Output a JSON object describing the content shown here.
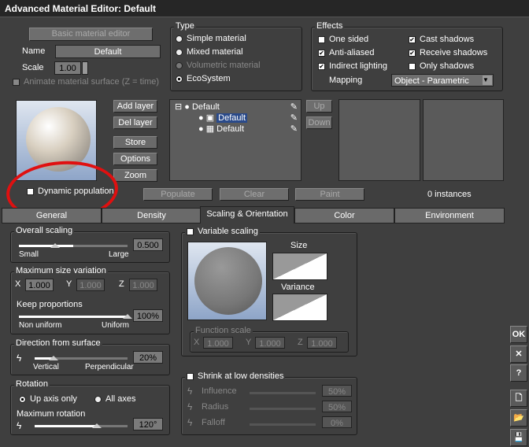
{
  "title": "Advanced Material Editor: Default",
  "basic_editor": "Basic material editor",
  "name_label": "Name",
  "name_value": "Default",
  "scale_label": "Scale",
  "scale_value": "1.00",
  "animate_label": "Animate material surface (Z = time)",
  "type": {
    "legend": "Type",
    "options": [
      "Simple material",
      "Mixed material",
      "Volumetric material",
      "EcoSystem"
    ],
    "selected": "EcoSystem"
  },
  "effects": {
    "legend": "Effects",
    "one_sided": "One sided",
    "anti_aliased": "Anti-aliased",
    "indirect_lighting": "Indirect lighting",
    "cast_shadows": "Cast shadows",
    "receive_shadows": "Receive shadows",
    "only_shadows": "Only shadows",
    "mapping_label": "Mapping",
    "mapping_value": "Object - Parametric"
  },
  "layer_buttons": [
    "Add layer",
    "Del layer",
    "Store",
    "Options",
    "Zoom"
  ],
  "tree": [
    "Default",
    "Default",
    "Default"
  ],
  "up": "Up",
  "down": "Down",
  "dynamic_population": "Dynamic population",
  "populate": "Populate",
  "clear": "Clear",
  "paint": "Paint",
  "instances": "0 instances",
  "tabs": [
    "General",
    "Density",
    "Scaling & Orientation",
    "Color",
    "Environment"
  ],
  "overall": {
    "legend": "Overall scaling",
    "min": "Small",
    "max": "Large",
    "value": "0.500",
    "fraction": 0.5
  },
  "size_var": {
    "legend": "Maximum size variation",
    "x": "1.000",
    "y": "1.000",
    "z": "1.000",
    "keep": "Keep proportions",
    "min": "Non uniform",
    "max": "Uniform",
    "value": "100%",
    "fraction": 1.0
  },
  "direction": {
    "legend": "Direction from surface",
    "min": "Vertical",
    "max": "Perpendicular",
    "value": "20%",
    "fraction": 0.2
  },
  "rotation": {
    "legend": "Rotation",
    "up_axis": "Up axis only",
    "all_axes": "All axes",
    "max_label": "Maximum rotation",
    "value": "120°",
    "fraction": 0.67
  },
  "variable": {
    "legend": "Variable scaling",
    "size": "Size",
    "variance": "Variance",
    "function_scale": "Function scale",
    "x": "1.000",
    "y": "1.000",
    "z": "1.000"
  },
  "shrink": {
    "legend": "Shrink at low densities",
    "influence": "Influence",
    "influence_value": "50%",
    "radius": "Radius",
    "radius_value": "50%",
    "falloff": "Falloff",
    "falloff_value": "0%"
  },
  "side": {
    "ok": "OK",
    "close": "✕",
    "help": "?"
  },
  "axes": {
    "x": "X",
    "y": "Y",
    "z": "Z"
  }
}
